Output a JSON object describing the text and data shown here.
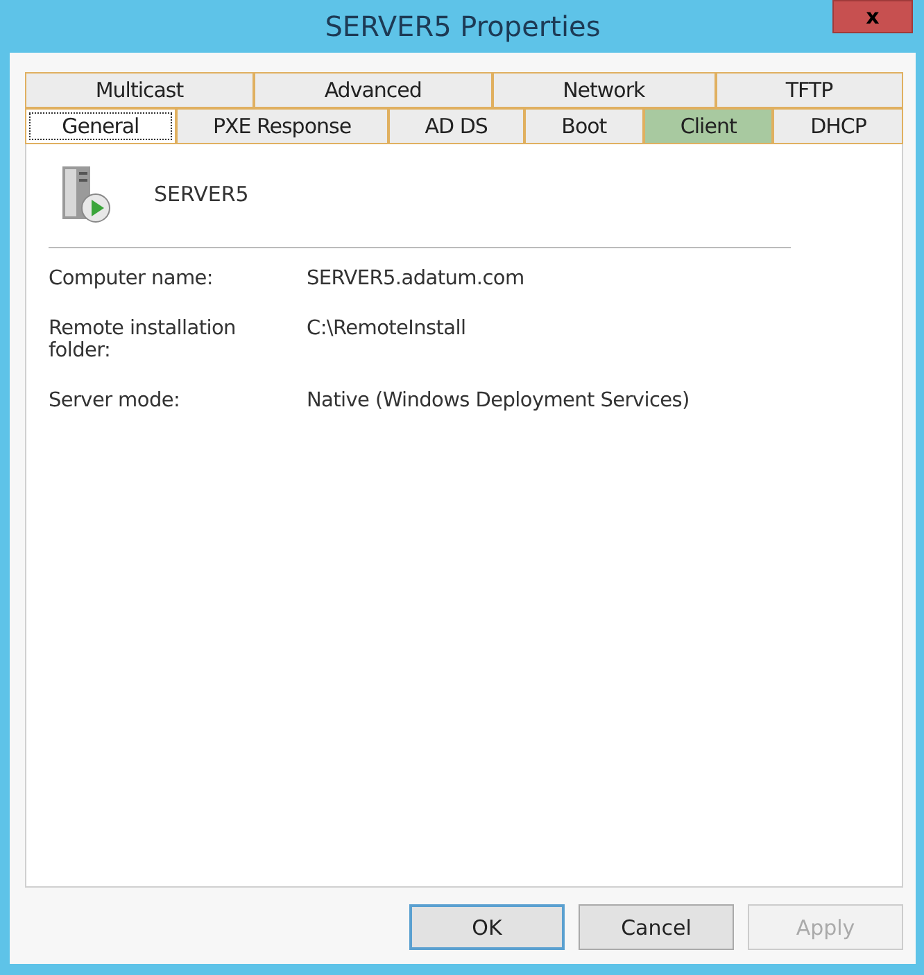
{
  "window": {
    "title": "SERVER5 Properties",
    "close": "x"
  },
  "tab_rows": [
    {
      "tabs": [
        {
          "label": "Multicast",
          "selected": false,
          "highlighted": false
        },
        {
          "label": "Advanced",
          "selected": false,
          "highlighted": false
        },
        {
          "label": "Network",
          "selected": false,
          "highlighted": false
        },
        {
          "label": "TFTP",
          "selected": false,
          "highlighted": false
        }
      ]
    },
    {
      "tabs": [
        {
          "label": "General",
          "selected": true,
          "highlighted": false
        },
        {
          "label": "PXE Response",
          "selected": false,
          "highlighted": false
        },
        {
          "label": "AD DS",
          "selected": false,
          "highlighted": false
        },
        {
          "label": "Boot",
          "selected": false,
          "highlighted": false
        },
        {
          "label": "Client",
          "selected": false,
          "highlighted": true
        },
        {
          "label": "DHCP",
          "selected": false,
          "highlighted": false
        }
      ]
    }
  ],
  "server": {
    "name": "SERVER5"
  },
  "properties": [
    {
      "label": "Computer name:",
      "value": "SERVER5.adatum.com"
    },
    {
      "label": "Remote installation folder:",
      "value": "C:\\RemoteInstall"
    },
    {
      "label": "Server mode:",
      "value": "Native (Windows Deployment Services)"
    }
  ],
  "buttons": [
    {
      "label": "OK",
      "disabled": false,
      "default": true
    },
    {
      "label": "Cancel",
      "disabled": false,
      "default": false
    },
    {
      "label": "Apply",
      "disabled": true,
      "default": false
    }
  ]
}
